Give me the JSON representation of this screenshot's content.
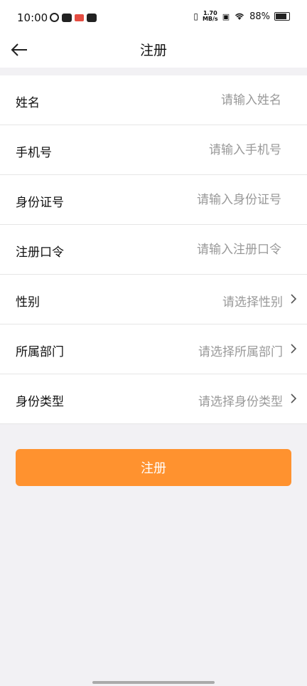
{
  "statusbar": {
    "time": "10:00",
    "speed_value": "1.70",
    "speed_unit": "MB/s",
    "battery": "88%"
  },
  "header": {
    "title": "注册"
  },
  "form": {
    "rows": [
      {
        "label": "姓名",
        "placeholder": "请输入姓名"
      },
      {
        "label": "手机号",
        "placeholder": "请输入手机号"
      },
      {
        "label": "身份证号",
        "placeholder": "请输入身份证号"
      },
      {
        "label": "注册口令",
        "placeholder": "请输入注册口令"
      },
      {
        "label": "性别",
        "select_text": "请选择性别"
      },
      {
        "label": "所属部门",
        "select_text": "请选择所属部门"
      },
      {
        "label": "身份类型",
        "select_text": "请选择身份类型"
      }
    ]
  },
  "submit": {
    "label": "注册",
    "color": "#ff922f"
  }
}
